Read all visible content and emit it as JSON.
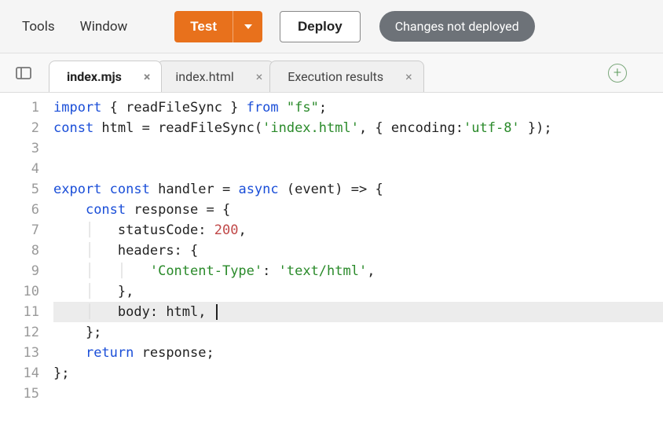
{
  "toolbar": {
    "menu": [
      "Tools",
      "Window"
    ],
    "test_label": "Test",
    "deploy_label": "Deploy",
    "not_deployed_label": "Changes not deployed"
  },
  "tabs": [
    {
      "label": "index.mjs",
      "active": true
    },
    {
      "label": "index.html",
      "active": false
    },
    {
      "label": "Execution results",
      "active": false
    }
  ],
  "code": {
    "lines": [
      {
        "n": 1,
        "segs": [
          {
            "t": "import",
            "c": "kw"
          },
          {
            "t": " { readFileSync } "
          },
          {
            "t": "from",
            "c": "kw"
          },
          {
            "t": " "
          },
          {
            "t": "\"fs\"",
            "c": "str"
          },
          {
            "t": ";"
          }
        ]
      },
      {
        "n": 2,
        "segs": [
          {
            "t": "const",
            "c": "kw"
          },
          {
            "t": " html = readFileSync("
          },
          {
            "t": "'index.html'",
            "c": "str"
          },
          {
            "t": ", { encoding:"
          },
          {
            "t": "'utf-8'",
            "c": "str"
          },
          {
            "t": " });"
          }
        ]
      },
      {
        "n": 3,
        "segs": []
      },
      {
        "n": 4,
        "segs": []
      },
      {
        "n": 5,
        "segs": [
          {
            "t": "export",
            "c": "kw"
          },
          {
            "t": " "
          },
          {
            "t": "const",
            "c": "kw"
          },
          {
            "t": " handler = "
          },
          {
            "t": "async",
            "c": "kw"
          },
          {
            "t": " (event) => {"
          }
        ]
      },
      {
        "n": 6,
        "segs": [
          {
            "t": "    "
          },
          {
            "t": "const",
            "c": "kw"
          },
          {
            "t": " response = {"
          }
        ]
      },
      {
        "n": 7,
        "segs": [
          {
            "t": "    "
          },
          {
            "t": "│   ",
            "c": "guide"
          },
          {
            "t": "statusCode: "
          },
          {
            "t": "200",
            "c": "num"
          },
          {
            "t": ","
          }
        ]
      },
      {
        "n": 8,
        "segs": [
          {
            "t": "    "
          },
          {
            "t": "│   ",
            "c": "guide"
          },
          {
            "t": "headers: {"
          }
        ]
      },
      {
        "n": 9,
        "segs": [
          {
            "t": "    "
          },
          {
            "t": "│   │   ",
            "c": "guide"
          },
          {
            "t": "'Content-Type'",
            "c": "str"
          },
          {
            "t": ": "
          },
          {
            "t": "'text/html'",
            "c": "str"
          },
          {
            "t": ","
          }
        ]
      },
      {
        "n": 10,
        "segs": [
          {
            "t": "    "
          },
          {
            "t": "│   ",
            "c": "guide"
          },
          {
            "t": "},"
          }
        ]
      },
      {
        "n": 11,
        "current": true,
        "segs": [
          {
            "t": "    "
          },
          {
            "t": "│   ",
            "c": "guide"
          },
          {
            "t": "body: html, "
          }
        ]
      },
      {
        "n": 12,
        "segs": [
          {
            "t": "    };"
          }
        ]
      },
      {
        "n": 13,
        "segs": [
          {
            "t": "    "
          },
          {
            "t": "return",
            "c": "kw"
          },
          {
            "t": " response;"
          }
        ]
      },
      {
        "n": 14,
        "segs": [
          {
            "t": "};"
          }
        ]
      },
      {
        "n": 15,
        "segs": []
      }
    ]
  }
}
